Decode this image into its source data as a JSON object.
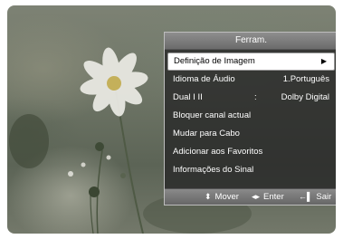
{
  "menu": {
    "title": "Ferram.",
    "items": [
      {
        "label": "Definição de Imagem",
        "value": "",
        "arrow": "▶",
        "selected": true
      },
      {
        "label": "Idioma de Áudio",
        "value": "1.Português"
      },
      {
        "label": "Dual I II",
        "separator": ":",
        "value": "Dolby Digital"
      },
      {
        "label": "Bloquer canal actual",
        "value": ""
      },
      {
        "label": "Mudar para Cabo",
        "value": ""
      },
      {
        "label": "Adicionar aos Favoritos",
        "value": ""
      },
      {
        "label": "Informações do Sinal",
        "value": ""
      }
    ]
  },
  "footer": {
    "move_icon": "⬍",
    "move_label": "Mover",
    "enter_icon": "◂▸",
    "enter_label": "Enter",
    "exit_icon": "←▌",
    "exit_label": "Sair"
  },
  "colors": {
    "panel_bg": "#282828",
    "selected_bg": "#ffffff",
    "title_bar": "#7a7a7a"
  }
}
